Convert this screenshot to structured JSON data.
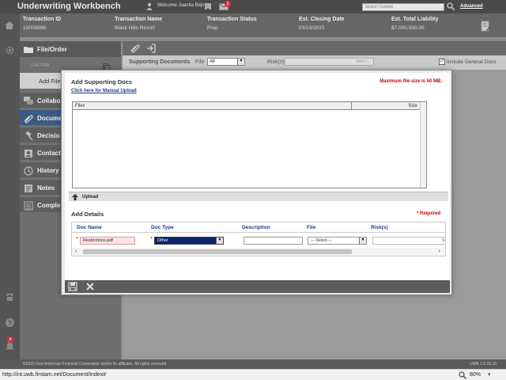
{
  "header": {
    "app_title": "Underwriting Workbench",
    "welcome": "Welcome Juanita Bejin",
    "mail_count": "2",
    "search_placeholder": "Search Content",
    "advanced_label": "Advanced"
  },
  "transaction": {
    "columns": [
      {
        "label": "Transaction ID",
        "value": "10008999"
      },
      {
        "label": "Transaction Name",
        "value": "Black Hills Resort"
      },
      {
        "label": "Transaction Status",
        "value": "Prep"
      },
      {
        "label": "Est. Closing Date",
        "value": "03/13/2015"
      },
      {
        "label": "Est. Total Liability",
        "value": "$7,000,000.00"
      }
    ]
  },
  "sidebar": {
    "file_order": "File/Order",
    "order_number": "1247438",
    "add_file": "Add File",
    "items": [
      {
        "label": "Collabo",
        "icon": "collaboration-icon"
      },
      {
        "label": "Docume",
        "icon": "paperclip-icon"
      },
      {
        "label": "Decisio",
        "icon": "gavel-icon"
      },
      {
        "label": "Contact",
        "icon": "contacts-icon"
      },
      {
        "label": "History",
        "icon": "clock-icon"
      },
      {
        "label": "Notes",
        "icon": "notes-icon"
      },
      {
        "label": "Comple",
        "icon": "checklist-icon"
      }
    ]
  },
  "rail": {
    "notification_count": "4"
  },
  "supporting_docs": {
    "title": "Supporting Documents",
    "file_label": "File",
    "file_value": "All",
    "risks_label": "Risk(s)",
    "risks_placeholder": "Select",
    "include_general_label": "Include General Docs",
    "include_general_checked": true
  },
  "modal": {
    "title": "Add Supporting Docs",
    "max_size": "Maximum file size is 50 MB.",
    "manual_upload": "Click here for Manual Upload",
    "files_col": "Files",
    "size_col": "Size",
    "upload_label": "Upload",
    "add_details": "Add Details",
    "required": "* Required",
    "details": {
      "columns": [
        "Doc Name",
        "Doc Type",
        "Description",
        "File",
        "Risk(s)"
      ],
      "row": {
        "doc_name": "Restrictions.pdf",
        "doc_type": "Other",
        "description": "",
        "file": "----Select----",
        "risks": "Sel"
      }
    }
  },
  "footer": {
    "copyright": "©2015 First American Financial Corporation and/or its affiliates. All rights reserved.",
    "version": "UWB 1.0.15.10"
  },
  "statusbar": {
    "url": "http://int.uwb.firstam.net/Document/Index#",
    "zoom": "80%"
  }
}
